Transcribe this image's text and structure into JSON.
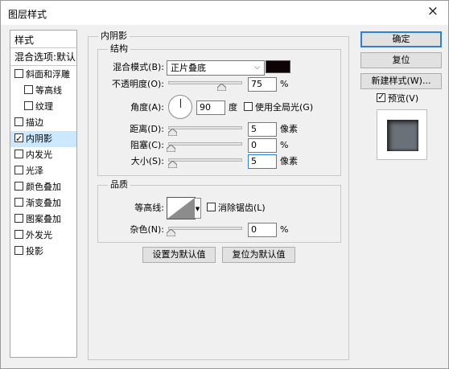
{
  "window": {
    "title": "图层样式",
    "close_glyph": "×"
  },
  "style_list": {
    "header": "样式",
    "blend_header": "混合选项:默认",
    "items": [
      {
        "label": "斜面和浮雕",
        "checked": false,
        "indent": false,
        "selected": false
      },
      {
        "label": "等高线",
        "checked": false,
        "indent": true,
        "selected": false
      },
      {
        "label": "纹理",
        "checked": false,
        "indent": true,
        "selected": false
      },
      {
        "label": "描边",
        "checked": false,
        "indent": false,
        "selected": false
      },
      {
        "label": "内阴影",
        "checked": true,
        "indent": false,
        "selected": true
      },
      {
        "label": "内发光",
        "checked": false,
        "indent": false,
        "selected": false
      },
      {
        "label": "光泽",
        "checked": false,
        "indent": false,
        "selected": false
      },
      {
        "label": "颜色叠加",
        "checked": false,
        "indent": false,
        "selected": false
      },
      {
        "label": "渐变叠加",
        "checked": false,
        "indent": false,
        "selected": false
      },
      {
        "label": "图案叠加",
        "checked": false,
        "indent": false,
        "selected": false
      },
      {
        "label": "外发光",
        "checked": false,
        "indent": false,
        "selected": false
      },
      {
        "label": "投影",
        "checked": false,
        "indent": false,
        "selected": false
      }
    ]
  },
  "inner_shadow": {
    "title": "内阴影",
    "structure": {
      "title": "结构",
      "blend_mode_label": "混合模式(B):",
      "blend_mode_value": "正片叠底",
      "shadow_color": "#0d0204",
      "opacity_label": "不透明度(O):",
      "opacity_value": "75",
      "opacity_fraction": 0.75,
      "percent": "%",
      "angle_label": "角度(A):",
      "angle_value": "90",
      "angle_unit": "度",
      "global_light_label": "使用全局光(G)",
      "global_light_checked": false,
      "distance_label": "距离(D):",
      "distance_value": "5",
      "distance_fraction": 0.02,
      "pixels_unit": "像素",
      "choke_label": "阻塞(C):",
      "choke_value": "0",
      "choke_fraction": 0.0,
      "size_label": "大小(S):",
      "size_value": "5",
      "size_fraction": 0.02
    },
    "quality": {
      "title": "品质",
      "contour_label": "等高线:",
      "antialias_label": "消除锯齿(L)",
      "antialias_checked": false,
      "noise_label": "杂色(N):",
      "noise_value": "0",
      "noise_fraction": 0.0
    },
    "set_default_label": "设置为默认值",
    "reset_default_label": "复位为默认值"
  },
  "buttons": {
    "ok": "确定",
    "reset": "复位",
    "new_style": "新建样式(W)...",
    "preview_label": "预览(V)",
    "preview_checked": true
  },
  "colors": {
    "selection": "#cce8ff",
    "focus": "#2f7fd6",
    "dialog_bg": "#f0f0f0"
  }
}
